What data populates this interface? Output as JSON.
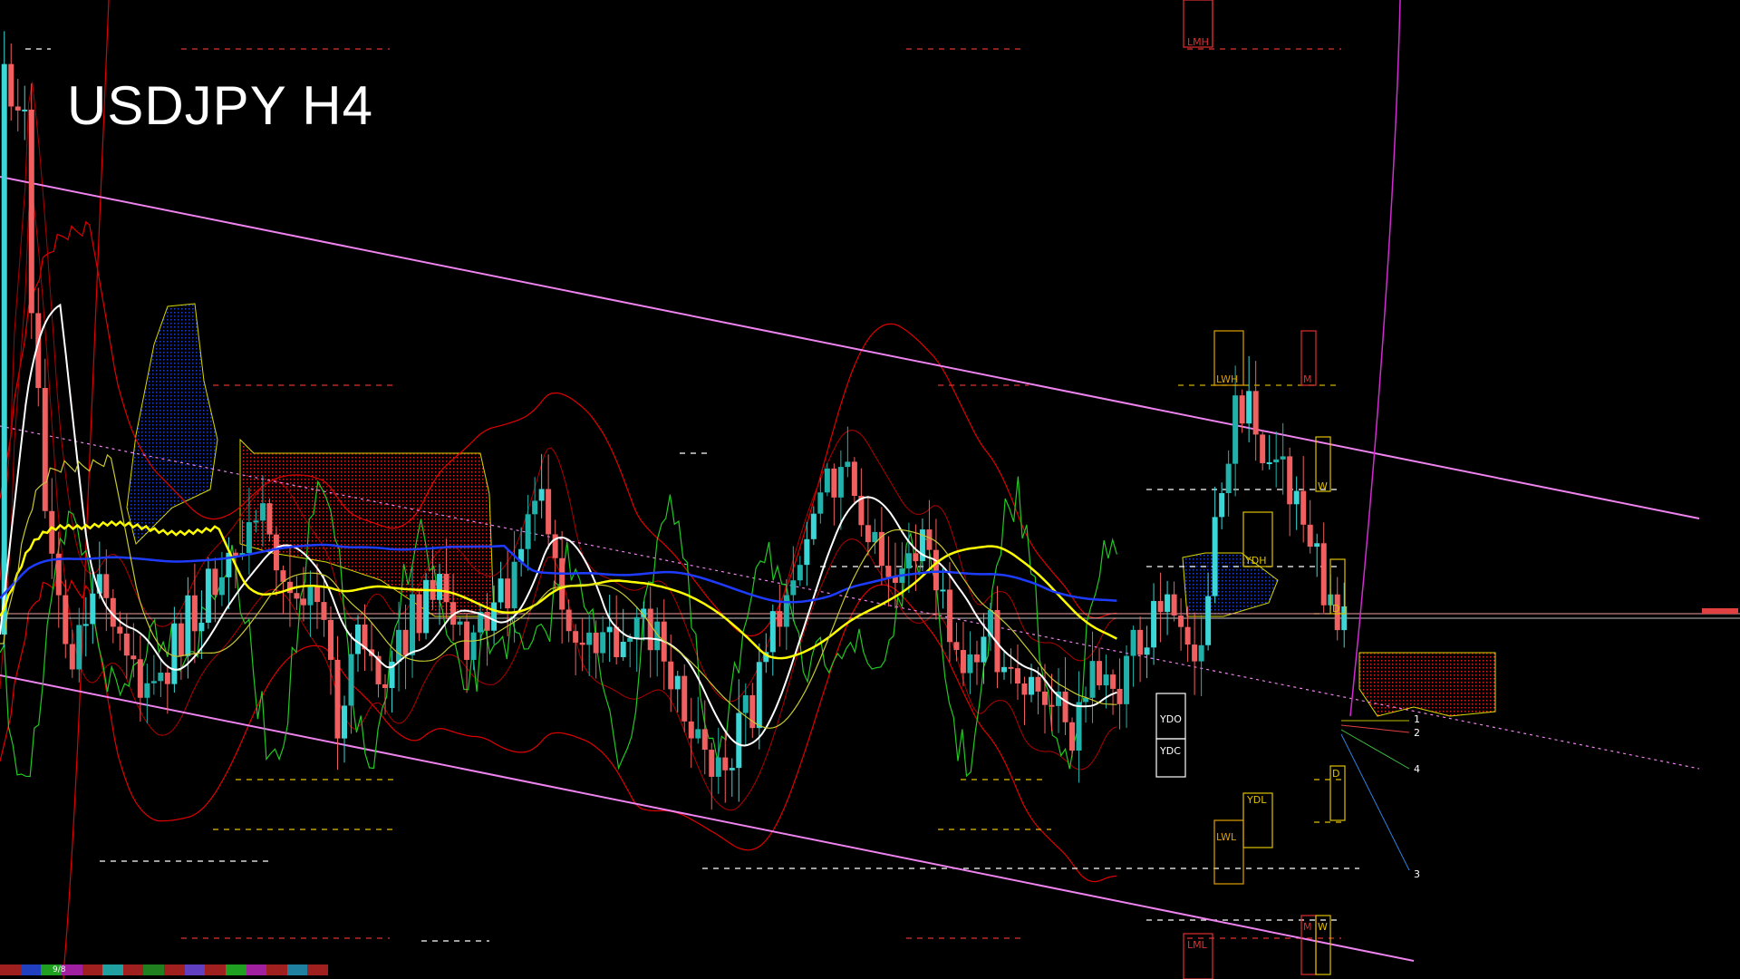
{
  "window": {
    "title": "USDJPY H4"
  },
  "chart_data": {
    "type": "line",
    "title": "USDJPY H4",
    "symbol": "USDJPY",
    "timeframe": "H4",
    "grid": false,
    "bull_color": "#20b2aa",
    "bull_highlight_color": "#3cd6d6",
    "bear_color": "#f06060",
    "levels": [
      {
        "label": "LMH"
      },
      {
        "label": "LWH"
      },
      {
        "label": "M"
      },
      {
        "label": "W"
      },
      {
        "label": "YDH"
      },
      {
        "label": "D"
      },
      {
        "label": "YDO"
      },
      {
        "label": "YDC"
      },
      {
        "label": "D"
      },
      {
        "label": "YDL"
      },
      {
        "label": "LWL"
      },
      {
        "label": "M"
      },
      {
        "label": "W"
      },
      {
        "label": "LML"
      }
    ],
    "projection_labels": [
      "1",
      "2",
      "4",
      "3"
    ],
    "status_strip_label": "9/8",
    "colors": {
      "channel": "#ee82ee",
      "bands": "#e00000",
      "ma_white": "#ffffff",
      "ma_yellow": "#ffff00",
      "ma_blue": "#1e3cff",
      "oscillator": "#22c822",
      "cloud_blue": "#1c3fd8",
      "cloud_red": "#e02020",
      "projection_magenta": "#d02cd0"
    }
  }
}
